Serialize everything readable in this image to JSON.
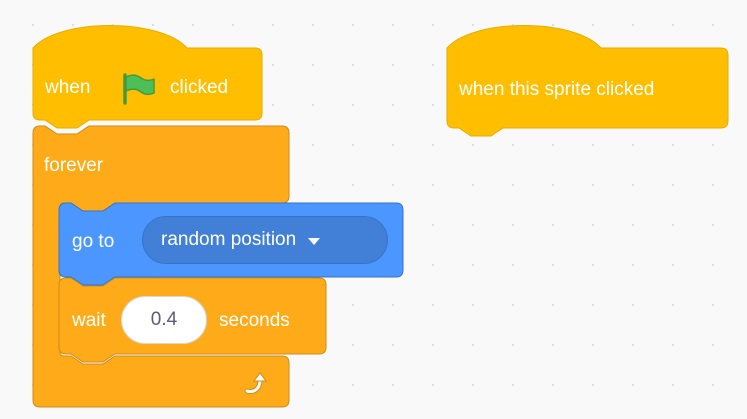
{
  "colors": {
    "events": "#ffbf00",
    "events_border": "#e6ac00",
    "control": "#ffab19",
    "control_border": "#cf8b17",
    "motion": "#4c97ff",
    "motion_border": "#3373cc",
    "flag": "#4cbf56"
  },
  "script1": {
    "hat": {
      "word1": "when",
      "flag_icon": "green-flag-icon",
      "word2": "clicked"
    },
    "forever": {
      "label": "forever",
      "loop_icon": "rotate-arrow-icon"
    },
    "goto": {
      "label": "go to",
      "menu_value": "random position"
    },
    "wait": {
      "label": "wait",
      "value": "0.4",
      "unit": "seconds"
    }
  },
  "script2": {
    "hat": {
      "label": "when this sprite clicked"
    }
  }
}
